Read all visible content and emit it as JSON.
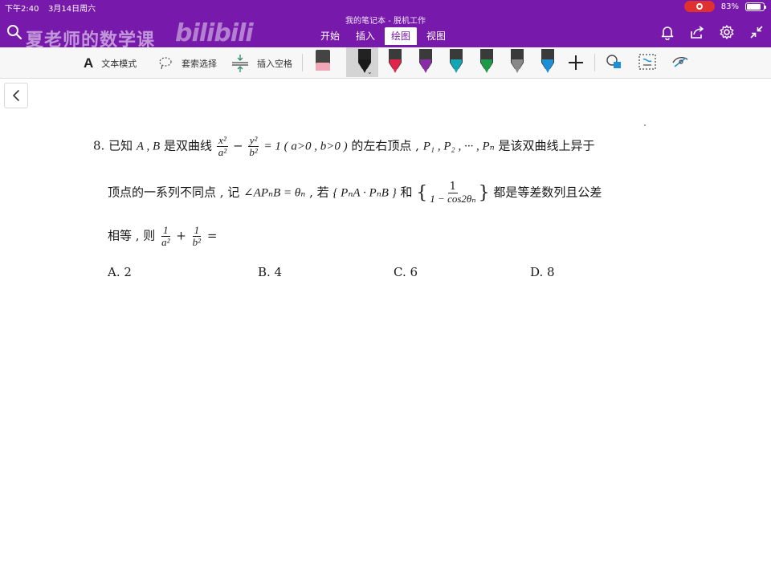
{
  "status_bar": {
    "time": "下午2:40",
    "date": "3月14日周六",
    "battery": "83%",
    "battery_level": 0.83
  },
  "app": {
    "window_title": "我的笔记本 - 脱机工作",
    "watermark": "夏老师的数学课",
    "logo": "bilibili",
    "tabs": [
      {
        "label": "开始"
      },
      {
        "label": "插入"
      },
      {
        "label": "绘图"
      },
      {
        "label": "视图"
      }
    ],
    "active_tab": "绘图"
  },
  "ribbon": {
    "text_mode": "文本模式",
    "lasso_select": "套索选择",
    "insert_space": "插入空格",
    "pens": [
      {
        "name": "black-pen",
        "color": "#1a1a1a"
      },
      {
        "name": "red-pen",
        "color": "#e0244a"
      },
      {
        "name": "purple-pen",
        "color": "#8a2ca8"
      },
      {
        "name": "teal-pen",
        "color": "#10a6b4"
      },
      {
        "name": "green-pen",
        "color": "#1d9a48"
      },
      {
        "name": "gray-pen",
        "color": "#888888"
      },
      {
        "name": "blue-highlighter",
        "color": "#1c8fd6"
      }
    ]
  },
  "problem": {
    "number": "8.",
    "line1_a": "已知",
    "vars_ab": "A , B",
    "line1_b": "是双曲线",
    "hyp_x": "x²",
    "hyp_a": "a²",
    "minus": "−",
    "hyp_y": "y²",
    "hyp_b": "b²",
    "line1_c": "= 1 ( a>0 , b>0 )",
    "line1_d": "的左右顶点 ,",
    "points": "P₁ , P₂ , ··· , Pₙ",
    "line1_e": "是该双曲线上异于",
    "line2_a": "顶点的一系列不同点 , 记",
    "angle": "∠APₙB = θₙ",
    "line2_b": ", 若",
    "dot_product": "{ PₙA · PₙB }",
    "line2_c": "和",
    "seq_num": "1",
    "seq_den": "1 − cos2θₙ",
    "line2_d": "都是等差数列且公差",
    "line3_a": "相等 , 则",
    "sum_num1": "1",
    "sum_den1": "a²",
    "plus": "+",
    "sum_num2": "1",
    "sum_den2": "b²",
    "equals": "=",
    "options": [
      {
        "label": "A. 2"
      },
      {
        "label": "B. 4"
      },
      {
        "label": "C. 6"
      },
      {
        "label": "D. 8"
      }
    ]
  }
}
